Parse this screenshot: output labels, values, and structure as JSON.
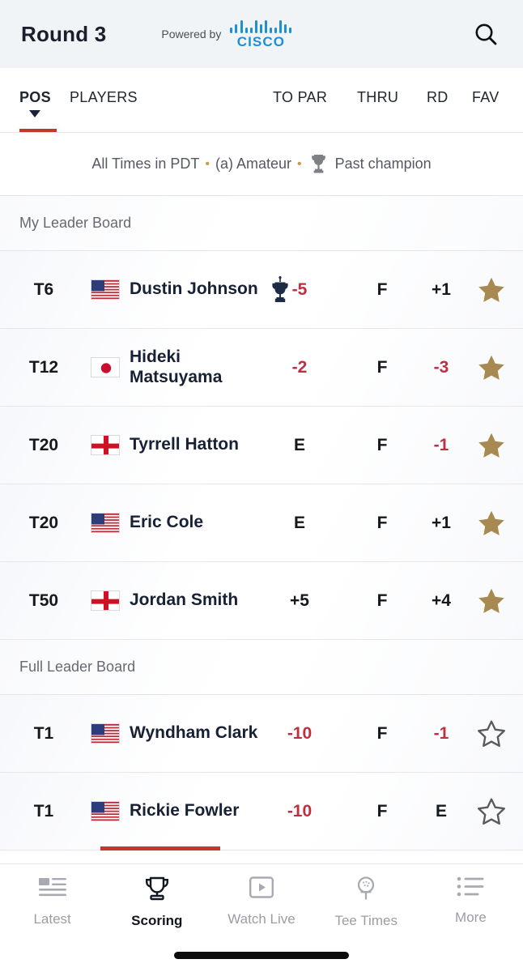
{
  "header": {
    "round_title": "Round 3",
    "powered_by": "Powered by",
    "sponsor": "CISCO",
    "search_icon": "search-icon"
  },
  "columns": {
    "pos": "POS",
    "players": "PLAYERS",
    "to_par": "TO PAR",
    "thru": "THRU",
    "rd": "RD",
    "fav": "FAV",
    "sort_active": "pos",
    "sort_direction": "descending"
  },
  "legend": {
    "times": "All Times in PDT",
    "sep1": "•",
    "amateur": "(a) Amateur",
    "sep2": "•",
    "past_champion": "Past champion",
    "trophy_icon": "trophy-icon"
  },
  "sections": [
    {
      "label": "My Leader Board",
      "rows": [
        {
          "pos": "T6",
          "country": "USA",
          "name": "Dustin Johnson",
          "past_champion": true,
          "to_par": "-5",
          "to_par_state": "under",
          "thru": "F",
          "rd": "+1",
          "rd_state": "over",
          "fav": true
        },
        {
          "pos": "T12",
          "country": "Japan",
          "name": "Hideki Matsuyama",
          "past_champion": false,
          "to_par": "-2",
          "to_par_state": "under",
          "thru": "F",
          "rd": "-3",
          "rd_state": "under",
          "fav": true
        },
        {
          "pos": "T20",
          "country": "England",
          "name": "Tyrrell Hatton",
          "past_champion": false,
          "to_par": "E",
          "to_par_state": "even",
          "thru": "F",
          "rd": "-1",
          "rd_state": "under",
          "fav": true
        },
        {
          "pos": "T20",
          "country": "USA",
          "name": "Eric Cole",
          "past_champion": false,
          "to_par": "E",
          "to_par_state": "even",
          "thru": "F",
          "rd": "+1",
          "rd_state": "over",
          "fav": true
        },
        {
          "pos": "T50",
          "country": "England",
          "name": "Jordan Smith",
          "past_champion": false,
          "to_par": "+5",
          "to_par_state": "over",
          "thru": "F",
          "rd": "+4",
          "rd_state": "over",
          "fav": true
        }
      ]
    },
    {
      "label": "Full Leader Board",
      "rows": [
        {
          "pos": "T1",
          "country": "USA",
          "name": "Wyndham Clark",
          "past_champion": false,
          "to_par": "-10",
          "to_par_state": "under",
          "thru": "F",
          "rd": "-1",
          "rd_state": "under",
          "fav": false
        },
        {
          "pos": "T1",
          "country": "USA",
          "name": "Rickie Fowler",
          "past_champion": false,
          "to_par": "-10",
          "to_par_state": "under",
          "thru": "F",
          "rd": "E",
          "rd_state": "even",
          "fav": false
        }
      ]
    }
  ],
  "tabbar": {
    "items": [
      {
        "label": "Latest",
        "icon": "news-icon",
        "active": false
      },
      {
        "label": "Scoring",
        "icon": "trophy-icon",
        "active": true
      },
      {
        "label": "Watch Live",
        "icon": "play-icon",
        "active": false
      },
      {
        "label": "Tee Times",
        "icon": "golf-tee-icon",
        "active": false
      },
      {
        "label": "More",
        "icon": "list-icon",
        "active": false
      }
    ]
  },
  "colors": {
    "accent_red": "#c0392b",
    "score_under": "#bf2f42",
    "fav_star_on": "#a8894f",
    "fav_star_off": "#5a5a5a",
    "cisco_blue": "#1c8fd6",
    "header_bg": "#f1f4f7",
    "name_navy": "#182034"
  }
}
